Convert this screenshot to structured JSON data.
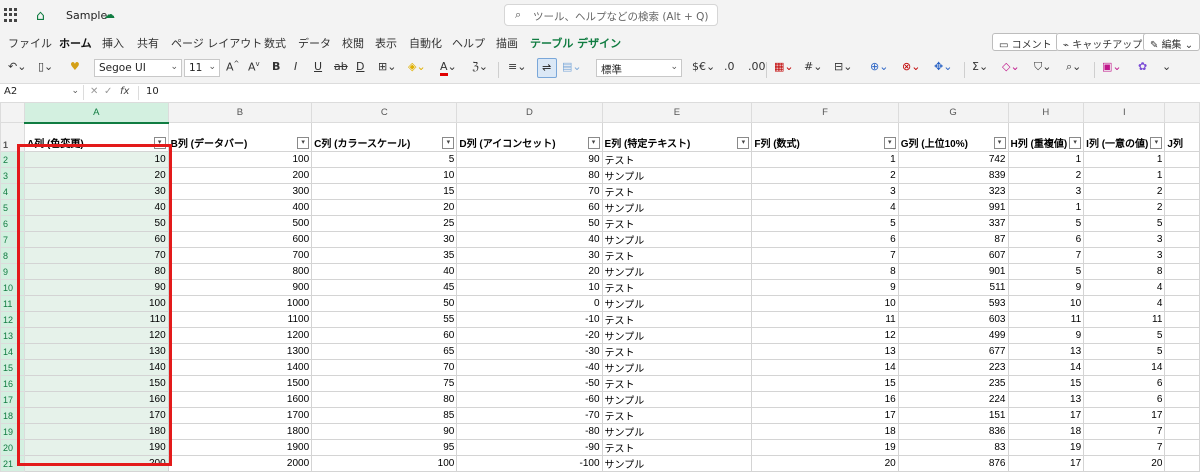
{
  "titlebar": {
    "doc_name": "Sample",
    "search_placeholder": "ツール、ヘルプなどの検索 (Alt + Q)"
  },
  "menu": {
    "items": [
      "ファイル",
      "ホーム",
      "挿入",
      "共有",
      "ページ レイアウト",
      "数式",
      "データ",
      "校閲",
      "表示",
      "自動化",
      "ヘルプ",
      "描画",
      "テーブル デザイン"
    ],
    "active": "ホーム",
    "comment_button": "コメント",
    "catchup_button": "キャッチアップ",
    "edit_button": "編集"
  },
  "ribbon": {
    "font_name": "Segoe UI",
    "font_size": "11",
    "number_format": "標準"
  },
  "formula_bar": {
    "name_box": "A2",
    "value": "10"
  },
  "columns": [
    "A",
    "B",
    "C",
    "D",
    "E",
    "F",
    "G",
    "H",
    "I"
  ],
  "headers": [
    "A列 (色変更)",
    "B列 (データバー)",
    "C列 (カラースケール)",
    "D列 (アイコンセット)",
    "E列 (特定テキスト)",
    "F列 (数式)",
    "G列 (上位10%)",
    "H列 (重複値)",
    "I列 (一意の値)",
    "J列"
  ],
  "row_numbers": [
    "1",
    "2",
    "3",
    "4",
    "5",
    "6",
    "7",
    "8",
    "9",
    "10",
    "11",
    "12",
    "13",
    "14",
    "15",
    "16",
    "17",
    "18",
    "19",
    "20",
    "21"
  ],
  "rows": [
    {
      "a": "10",
      "b": "100",
      "c": "5",
      "d": "90",
      "e": "テスト",
      "f": "1",
      "g": "742",
      "h": "1",
      "i": "1"
    },
    {
      "a": "20",
      "b": "200",
      "c": "10",
      "d": "80",
      "e": "サンプル",
      "f": "2",
      "g": "839",
      "h": "2",
      "i": "1"
    },
    {
      "a": "30",
      "b": "300",
      "c": "15",
      "d": "70",
      "e": "テスト",
      "f": "3",
      "g": "323",
      "h": "3",
      "i": "2"
    },
    {
      "a": "40",
      "b": "400",
      "c": "20",
      "d": "60",
      "e": "サンプル",
      "f": "4",
      "g": "991",
      "h": "1",
      "i": "2"
    },
    {
      "a": "50",
      "b": "500",
      "c": "25",
      "d": "50",
      "e": "テスト",
      "f": "5",
      "g": "337",
      "h": "5",
      "i": "5"
    },
    {
      "a": "60",
      "b": "600",
      "c": "30",
      "d": "40",
      "e": "サンプル",
      "f": "6",
      "g": "87",
      "h": "6",
      "i": "3"
    },
    {
      "a": "70",
      "b": "700",
      "c": "35",
      "d": "30",
      "e": "テスト",
      "f": "7",
      "g": "607",
      "h": "7",
      "i": "3"
    },
    {
      "a": "80",
      "b": "800",
      "c": "40",
      "d": "20",
      "e": "サンプル",
      "f": "8",
      "g": "901",
      "h": "5",
      "i": "8"
    },
    {
      "a": "90",
      "b": "900",
      "c": "45",
      "d": "10",
      "e": "テスト",
      "f": "9",
      "g": "511",
      "h": "9",
      "i": "4"
    },
    {
      "a": "100",
      "b": "1000",
      "c": "50",
      "d": "0",
      "e": "サンプル",
      "f": "10",
      "g": "593",
      "h": "10",
      "i": "4"
    },
    {
      "a": "110",
      "b": "1100",
      "c": "55",
      "d": "-10",
      "e": "テスト",
      "f": "11",
      "g": "603",
      "h": "11",
      "i": "11"
    },
    {
      "a": "120",
      "b": "1200",
      "c": "60",
      "d": "-20",
      "e": "サンプル",
      "f": "12",
      "g": "499",
      "h": "9",
      "i": "5"
    },
    {
      "a": "130",
      "b": "1300",
      "c": "65",
      "d": "-30",
      "e": "テスト",
      "f": "13",
      "g": "677",
      "h": "13",
      "i": "5"
    },
    {
      "a": "140",
      "b": "1400",
      "c": "70",
      "d": "-40",
      "e": "サンプル",
      "f": "14",
      "g": "223",
      "h": "14",
      "i": "14"
    },
    {
      "a": "150",
      "b": "1500",
      "c": "75",
      "d": "-50",
      "e": "テスト",
      "f": "15",
      "g": "235",
      "h": "15",
      "i": "6"
    },
    {
      "a": "160",
      "b": "1600",
      "c": "80",
      "d": "-60",
      "e": "サンプル",
      "f": "16",
      "g": "224",
      "h": "13",
      "i": "6"
    },
    {
      "a": "170",
      "b": "1700",
      "c": "85",
      "d": "-70",
      "e": "テスト",
      "f": "17",
      "g": "151",
      "h": "17",
      "i": "17"
    },
    {
      "a": "180",
      "b": "1800",
      "c": "90",
      "d": "-80",
      "e": "サンプル",
      "f": "18",
      "g": "836",
      "h": "18",
      "i": "7"
    },
    {
      "a": "190",
      "b": "1900",
      "c": "95",
      "d": "-90",
      "e": "テスト",
      "f": "19",
      "g": "83",
      "h": "19",
      "i": "7"
    },
    {
      "a": "200",
      "b": "2000",
      "c": "100",
      "d": "-100",
      "e": "サンプル",
      "f": "20",
      "g": "876",
      "h": "17",
      "i": "20"
    }
  ],
  "colors": {
    "accent": "#107c41",
    "highlight_box": "#e31a1a",
    "selection_fill": "#e6f2ea"
  }
}
